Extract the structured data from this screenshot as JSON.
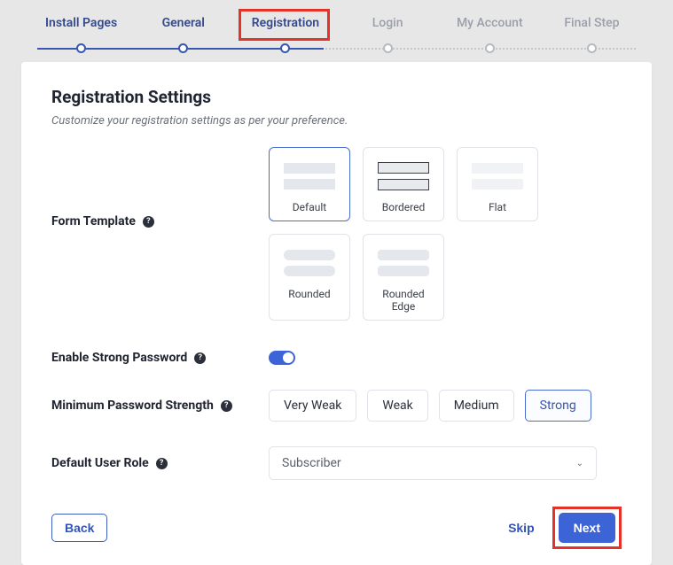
{
  "stepper": {
    "steps": [
      {
        "label": "Install Pages",
        "state": "done"
      },
      {
        "label": "General",
        "state": "done"
      },
      {
        "label": "Registration",
        "state": "active"
      },
      {
        "label": "Login",
        "state": "upcoming"
      },
      {
        "label": "My Account",
        "state": "upcoming"
      },
      {
        "label": "Final Step",
        "state": "upcoming"
      }
    ]
  },
  "page": {
    "title": "Registration Settings",
    "subtitle": "Customize your registration settings as per your preference."
  },
  "fields": {
    "formTemplate": {
      "label": "Form Template",
      "options": [
        "Default",
        "Bordered",
        "Flat",
        "Rounded",
        "Rounded Edge"
      ],
      "selected": "Default"
    },
    "strongPassword": {
      "label": "Enable Strong Password",
      "value": true
    },
    "minStrength": {
      "label": "Minimum Password Strength",
      "options": [
        "Very Weak",
        "Weak",
        "Medium",
        "Strong"
      ],
      "selected": "Strong"
    },
    "defaultRole": {
      "label": "Default User Role",
      "value": "Subscriber"
    }
  },
  "footer": {
    "back": "Back",
    "skip": "Skip",
    "next": "Next"
  }
}
